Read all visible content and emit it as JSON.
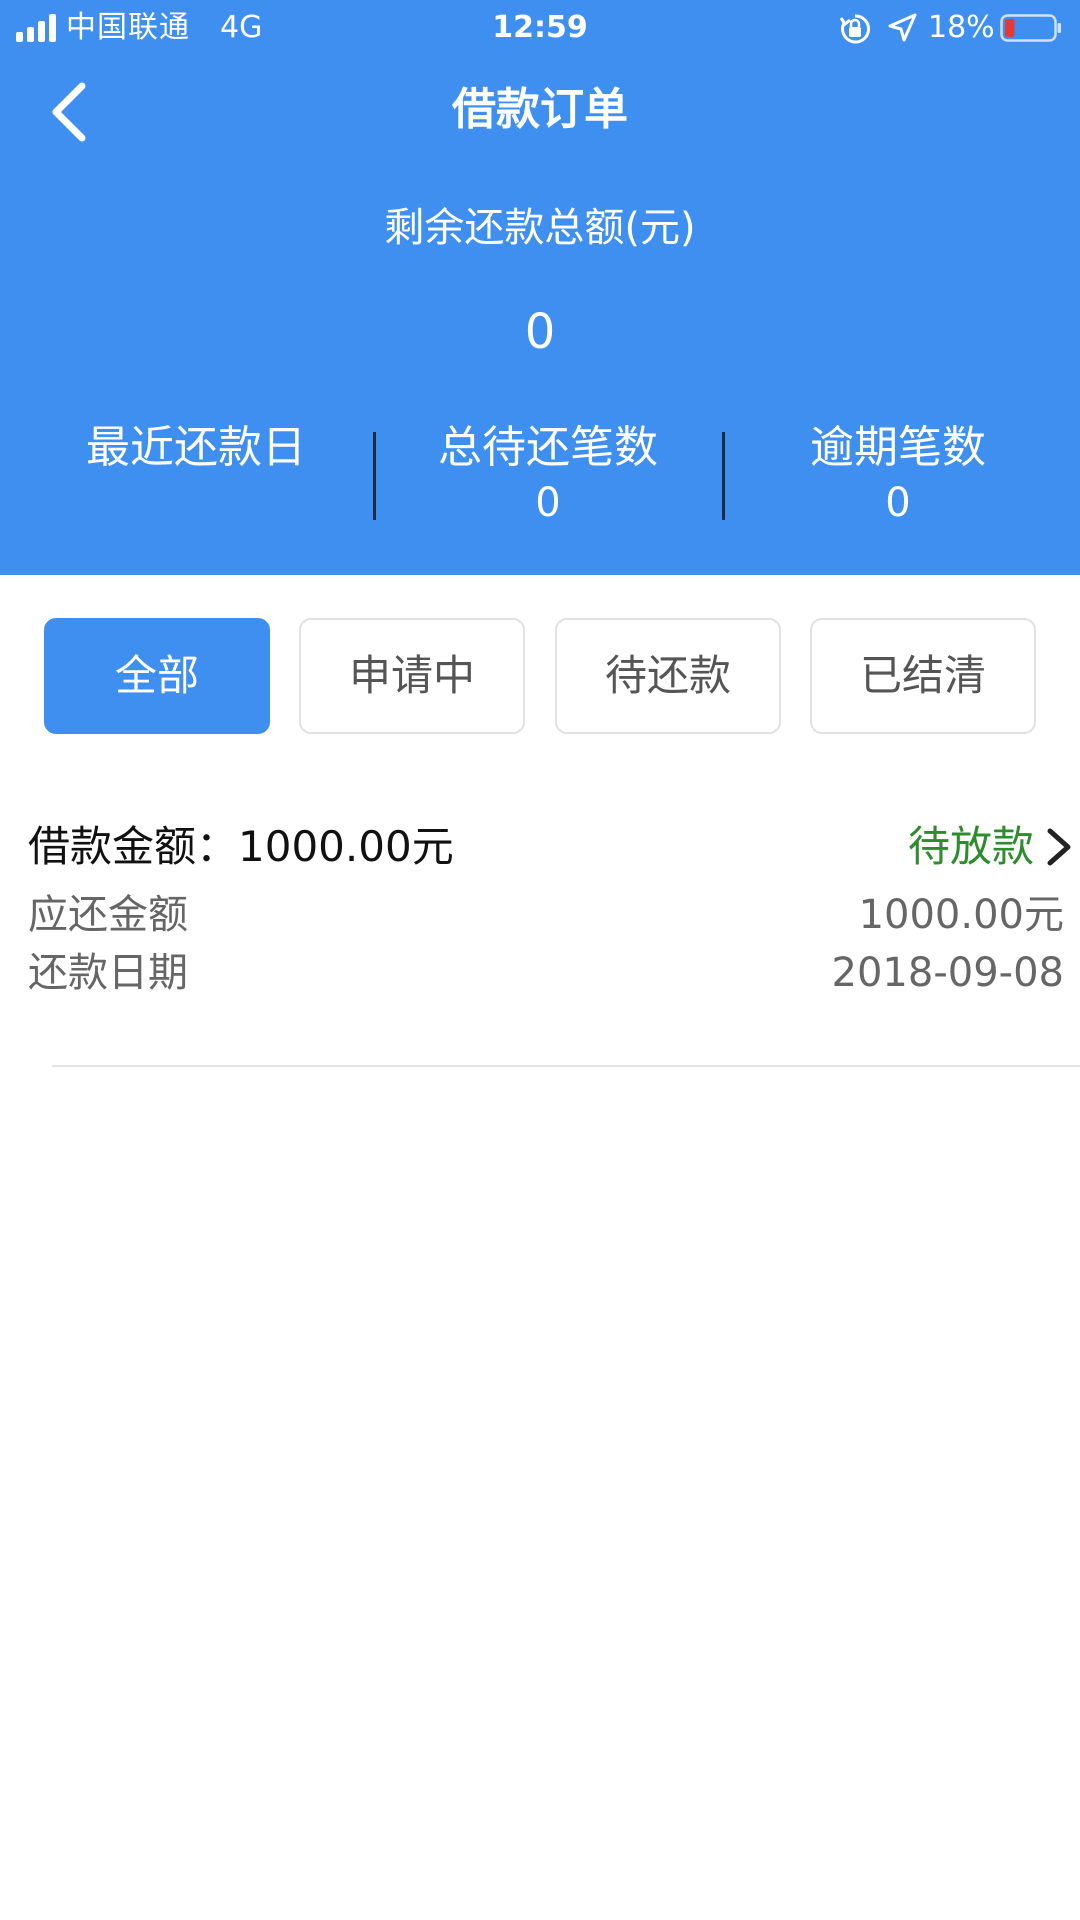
{
  "status_bar": {
    "carrier": "中国联通",
    "network": "4G",
    "time": "12:59",
    "battery": "18%",
    "battery_level": 0.18,
    "battery_color": "#e53935"
  },
  "nav": {
    "title": "借款订单",
    "back_icon": "chevron-left-icon"
  },
  "summary": {
    "remaining_label": "剩余还款总额(元)",
    "remaining_value": "0",
    "stats": [
      {
        "label": "最近还款日",
        "value": ""
      },
      {
        "label": "总待还笔数",
        "value": "0"
      },
      {
        "label": "逾期笔数",
        "value": "0"
      }
    ]
  },
  "tabs": [
    {
      "label": "全部",
      "active": true
    },
    {
      "label": "申请中",
      "active": false
    },
    {
      "label": "待还款",
      "active": false
    },
    {
      "label": "已结清",
      "active": false
    }
  ],
  "order": {
    "amount_label": "借款金额：",
    "amount_value": "1000.00元",
    "status": "待放款",
    "rows": [
      {
        "label": "应还金额",
        "value": "1000.00元"
      },
      {
        "label": "还款日期",
        "value": "2018-09-08"
      }
    ]
  },
  "colors": {
    "primary": "#3f8ff0",
    "status_green": "#2e8b2e"
  }
}
